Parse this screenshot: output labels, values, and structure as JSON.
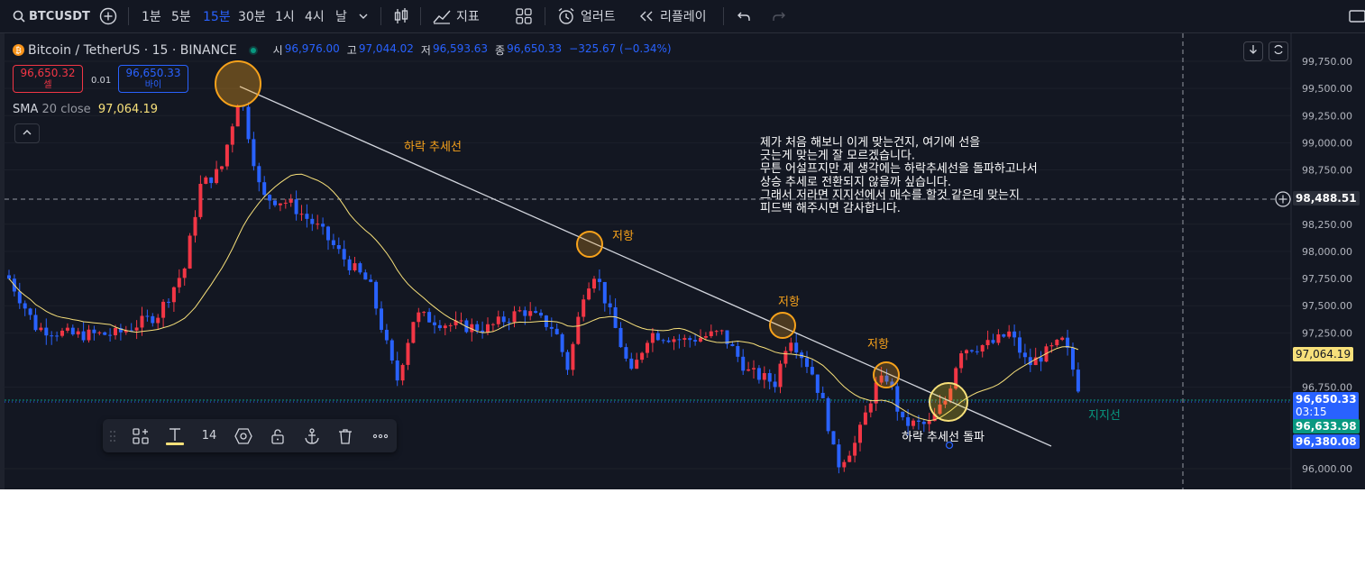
{
  "topbar": {
    "symbol": "BTCUSDT",
    "intervals": [
      "1분",
      "5분",
      "15분",
      "30분",
      "1시",
      "4시",
      "날"
    ],
    "active_interval": "15분",
    "indicators_label": "지표",
    "alert_label": "얼러트",
    "replay_label": "리플레이"
  },
  "legend": {
    "title": "Bitcoin / TetherUS · 15 · BINANCE",
    "open_key": "시",
    "open": "96,976.00",
    "high_key": "고",
    "high": "97,044.02",
    "low_key": "저",
    "low": "96,593.63",
    "close_key": "종",
    "close": "96,650.33",
    "change": "−325.67 (−0.34%)",
    "sell_price": "96,650.32",
    "sell_label": "셀",
    "spread": "0.01",
    "buy_price": "96,650.33",
    "buy_label": "바이",
    "sma_name": "SMA",
    "sma_params": "20 close",
    "sma_value": "97,064.19"
  },
  "axis": {
    "ticks": [
      "99,750.00",
      "99,500.00",
      "99,250.00",
      "99,000.00",
      "98,750.00",
      "98,250.00",
      "98,000.00",
      "97,750.00",
      "97,500.00",
      "97,250.00",
      "96,750.00",
      "96,000.00"
    ],
    "crosshair_price": "98,488.51",
    "sma_tag": "97,064.19",
    "last_price": "96,650.33",
    "countdown": "03:15",
    "green_tag": "96,633.98",
    "blue_tag": "96,380.08"
  },
  "annotations": {
    "downtrend": "하락 추세선",
    "resistance1": "저항",
    "resistance2": "저항",
    "resistance3": "저항",
    "breakout": "하락 추세선 돌파",
    "support": "지지선",
    "note": "제가 처음 해보니 이게 맞는건지, 여기에 선을\n긋는게 맞는게 잘 모르겠습니다.\n무튼 어설프지만 제 생각에는 하락추세선을 돌파하고나서\n상승 추세로 전환되지 않을까 싶습니다.\n그래서 저라면 지지선에서 매수를 할것 같은데 맞는지\n피드백 해주시면 감사합니다."
  },
  "drawing_toolbar": {
    "font_size": "14"
  },
  "colors": {
    "bg": "#131722",
    "up": "#f23645",
    "down": "#2962ff",
    "sma": "#f7e07a",
    "annotation": "#f7a21b",
    "support": "#089981"
  }
}
